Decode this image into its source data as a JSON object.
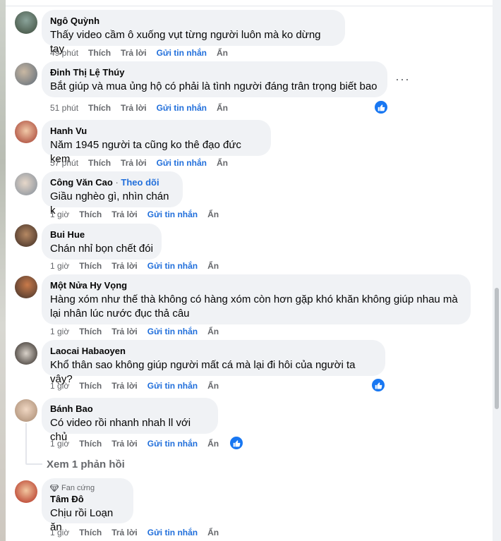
{
  "comments": [
    {
      "author": "Ngô Quỳnh",
      "text": "Thấy video cầm ô xuống vụt từng người luôn mà ko dừng tay",
      "time": "49 phút",
      "like": "Thích",
      "reply": "Trả lời",
      "message": "Gửi tin nhắn",
      "hide": "Ẩn"
    },
    {
      "author": "Đinh Thị Lệ Thúy",
      "text": "Bắt giúp và mua ủng hộ có phải là tình người đáng trân trọng biết bao",
      "time": "51 phút",
      "like": "Thích",
      "reply": "Trả lời",
      "message": "Gửi tin nhắn",
      "hide": "Ẩn"
    },
    {
      "author": "Hanh Vu",
      "text": "Năm 1945 người ta cũng ko thê đạo đức kem",
      "time": "57 phút",
      "like": "Thích",
      "reply": "Trả lời",
      "message": "Gửi tin nhắn",
      "hide": "Ẩn"
    },
    {
      "author": "Công Văn Cao",
      "follow": "Theo dõi",
      "text": "Giầu nghèo gì, nhìn chán k",
      "time": "1 giờ",
      "like": "Thích",
      "reply": "Trả lời",
      "message": "Gửi tin nhắn",
      "hide": "Ẩn"
    },
    {
      "author": "Bui Hue",
      "text": "Chán nhỉ bọn chết đói",
      "time": "1 giờ",
      "like": "Thích",
      "reply": "Trả lời",
      "message": "Gửi tin nhắn",
      "hide": "Ẩn"
    },
    {
      "author": "Một Nửa Hy Vọng",
      "text": "Hàng xóm như thế thà không có hàng xóm còn hơn gặp khó khăn không giúp nhau mà lại nhân lúc nước đục thả câu",
      "time": "1 giờ",
      "like": "Thích",
      "reply": "Trả lời",
      "message": "Gửi tin nhắn",
      "hide": "Ẩn"
    },
    {
      "author": "Laocai Habaoyen",
      "text": "Khổ thân sao không giúp người mất cá mà lại đi hôi của người ta vậy?",
      "time": "1 giờ",
      "like": "Thích",
      "reply": "Trả lời",
      "message": "Gửi tin nhắn",
      "hide": "Ẩn"
    },
    {
      "author": "Bánh Bao",
      "text": "Có video rồi nhanh nhah ll với chủ",
      "time": "1 giờ",
      "like": "Thích",
      "reply": "Trả lời",
      "message": "Gửi tin nhắn",
      "hide": "Ẩn"
    },
    {
      "author": "Tâm Đô",
      "badge": "Fan cứng",
      "text": "Chịu rồi Loạn ăn",
      "time": "1 giờ",
      "like": "Thích",
      "reply": "Trả lời",
      "message": "Gửi tin nhắn",
      "hide": "Ẩn"
    }
  ],
  "view_replies": "Xem 1 phản hồi",
  "more_menu": "···",
  "colors": {
    "bubble": "#f0f2f5",
    "link": "#216fdb",
    "muted": "#65676b",
    "like_badge": "#1877f2"
  },
  "icons": [
    "like-reaction-icon",
    "diamond-icon",
    "more-options-icon"
  ]
}
